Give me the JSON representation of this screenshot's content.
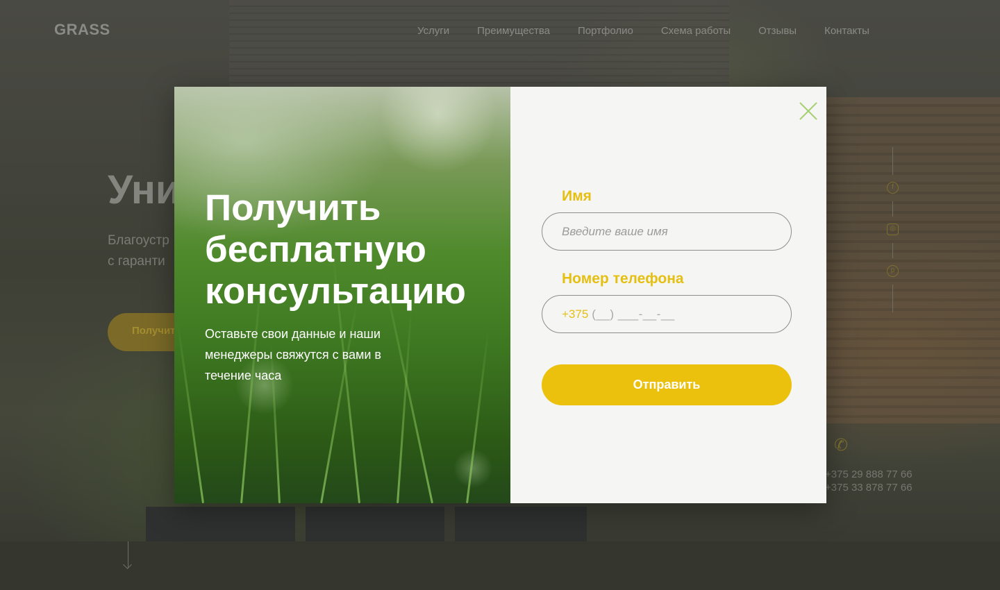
{
  "site": {
    "logo": "GRASS",
    "nav": [
      "Услуги",
      "Преимущества",
      "Портфолио",
      "Схема работы",
      "Отзывы",
      "Контакты"
    ],
    "hero_title": "Уни",
    "hero_subtitle_line1": "Благоустр",
    "hero_subtitle_line2": "с гаранти",
    "hero_button": "Получит",
    "phones": [
      "+375 29 888 77 66",
      "+375 33 878 77 66"
    ],
    "social_icons": [
      "facebook-icon",
      "instagram-icon",
      "pinterest-icon"
    ]
  },
  "modal": {
    "title": "Получить бесплатную консультацию",
    "description": "Оставьте свои данные и наши менеджеры свяжутся с вами в течение часа",
    "name_label": "Имя",
    "name_placeholder": "Введите ваше имя",
    "phone_label": "Номер телефона",
    "phone_prefix": "+375",
    "phone_mask": "(__) ___-__-__",
    "submit_label": "Отправить",
    "close_icon": "close-icon"
  },
  "colors": {
    "accent": "#EBC10E",
    "label": "#E5BF12",
    "close": "#A4CF6E",
    "modal_bg": "#F5F5F3"
  }
}
